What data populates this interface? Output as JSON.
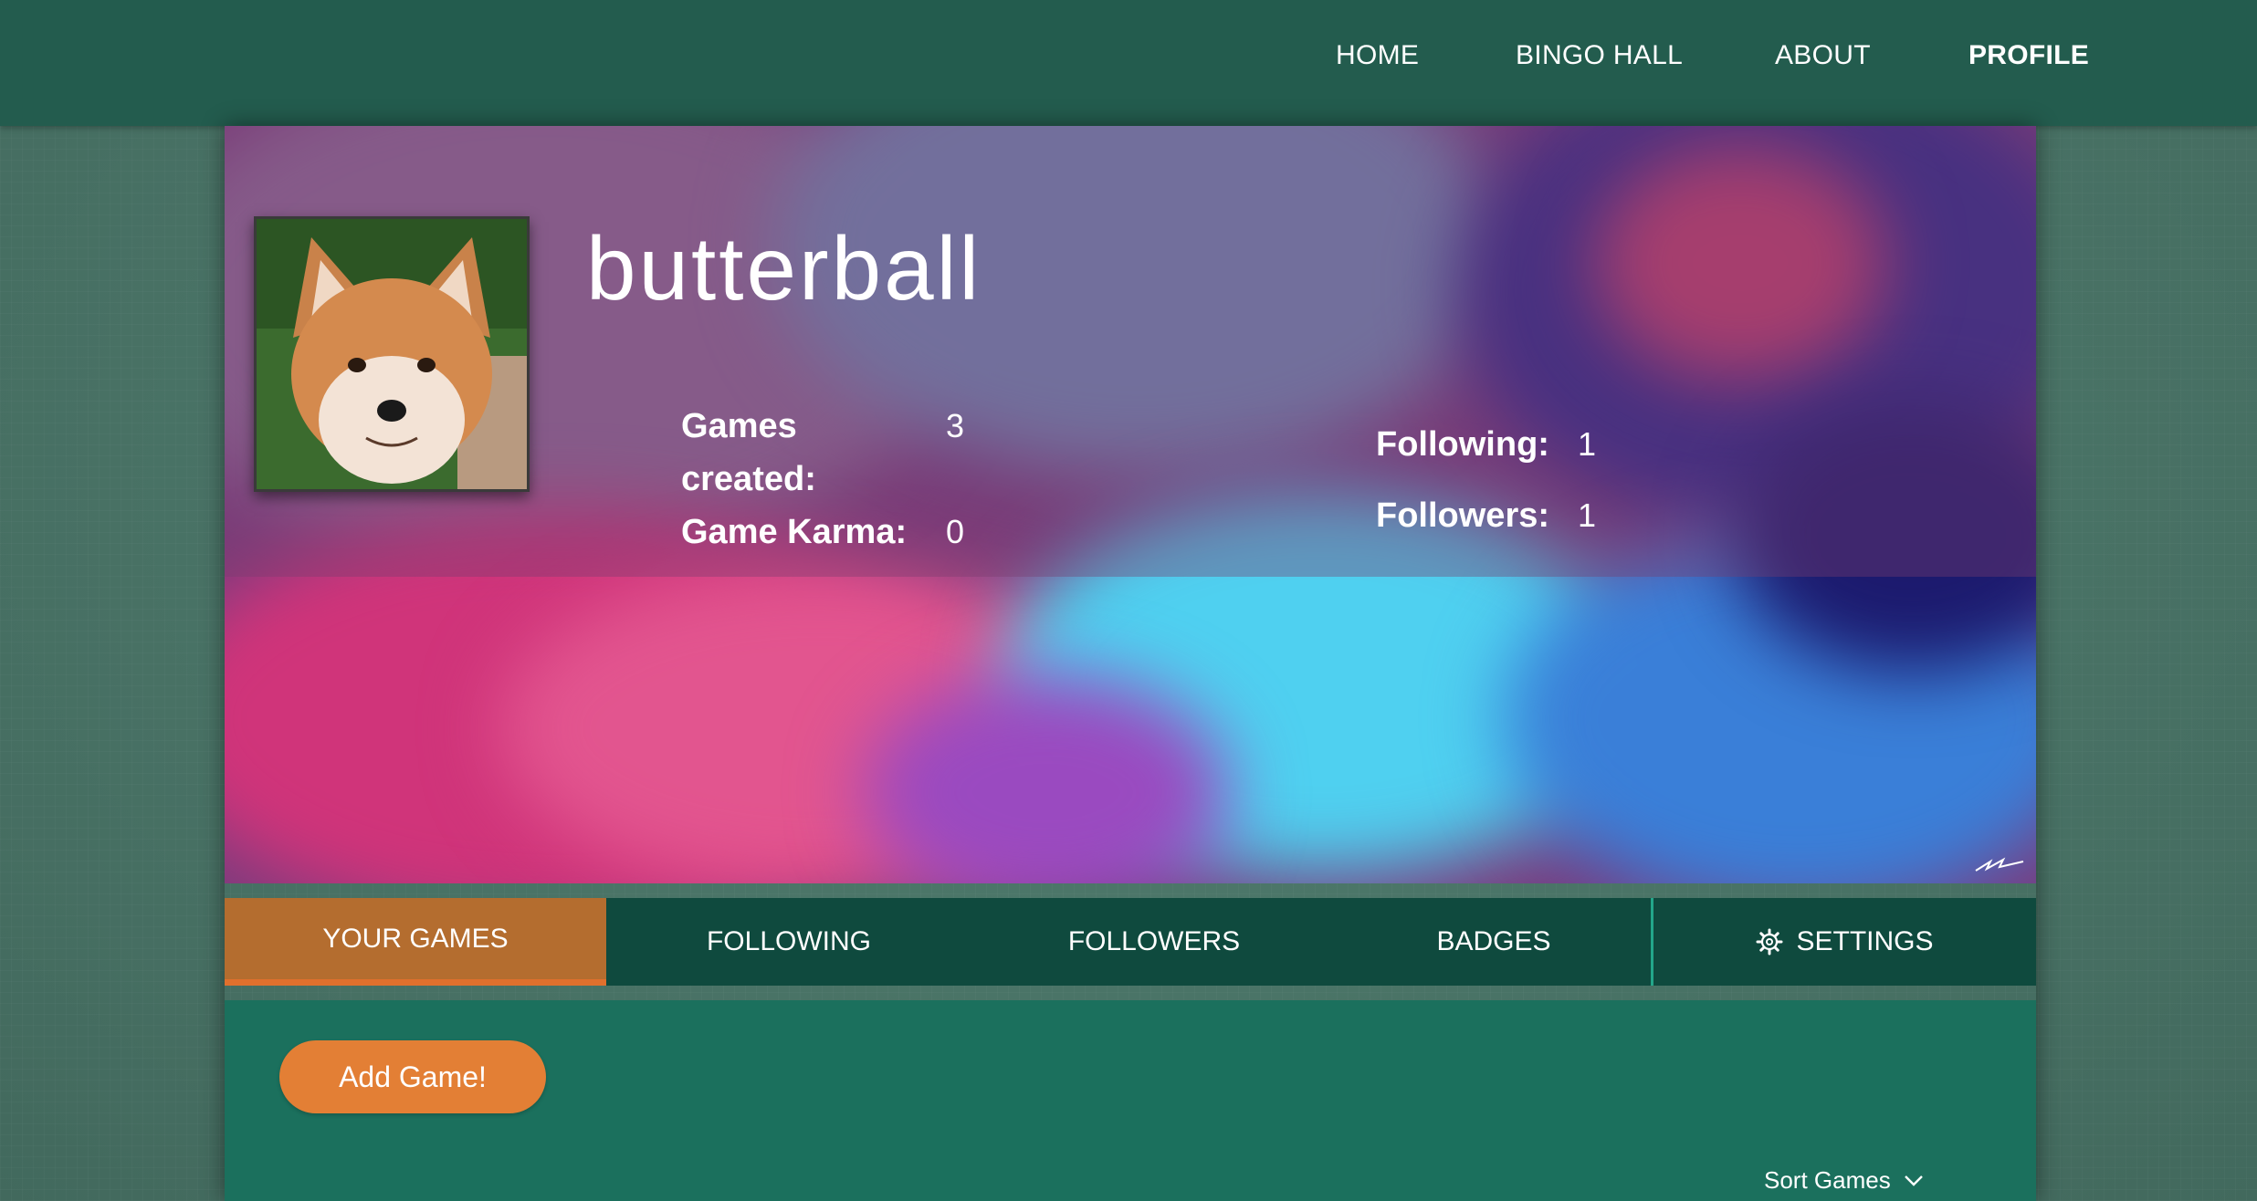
{
  "nav": {
    "home": "HOME",
    "bingo_hall": "BINGO HALL",
    "about": "ABOUT",
    "profile": "PROFILE",
    "active": "PROFILE"
  },
  "profile": {
    "username": "butterball",
    "avatar_icon": "fox-photo",
    "stats": {
      "games_created_label_line1": "Games",
      "games_created_label_line2": "created:",
      "games_created_value": "3",
      "game_karma_label": "Game Karma:",
      "game_karma_value": "0",
      "following_label": "Following:",
      "following_value": "1",
      "followers_label": "Followers:",
      "followers_value": "1"
    }
  },
  "tabs": {
    "your_games": "YOUR GAMES",
    "following": "FOLLOWING",
    "followers": "FOLLOWERS",
    "badges": "BADGES",
    "settings": "SETTINGS",
    "settings_icon": "gear-icon",
    "active": "YOUR GAMES"
  },
  "content": {
    "add_game_label": "Add Game!",
    "sort_label": "Sort Games",
    "sort_icon": "chevron-down-icon"
  },
  "colors": {
    "topbar": "#235c4e",
    "tabbar": "#0f4a3e",
    "active_tab": "#b46d2f",
    "accent": "#e37f35",
    "content_bg": "#1b705d"
  }
}
